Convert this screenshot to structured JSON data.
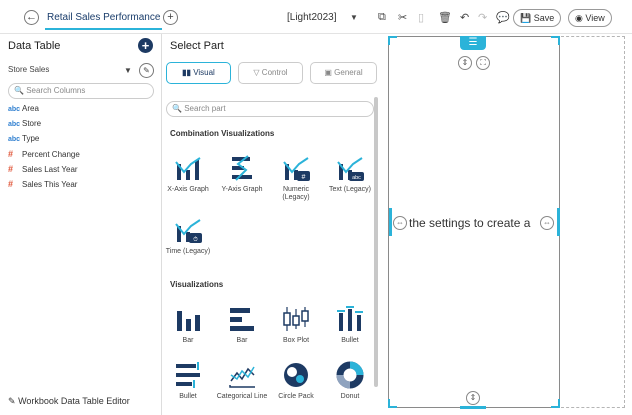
{
  "topbar": {
    "tab_label": "Retail Sales Performance",
    "theme": "[Light2023]",
    "save_label": "Save",
    "view_label": "View"
  },
  "left_panel": {
    "title": "Data Table",
    "source": "Store Sales",
    "search_placeholder": "Search Columns",
    "columns": [
      {
        "type": "abc",
        "name": "Area"
      },
      {
        "type": "abc",
        "name": "Store"
      },
      {
        "type": "abc",
        "name": "Type"
      },
      {
        "type": "#",
        "name": "Percent Change"
      },
      {
        "type": "#",
        "name": "Sales Last Year"
      },
      {
        "type": "#",
        "name": "Sales This Year"
      }
    ],
    "footer": "Workbook Data Table Editor"
  },
  "middle_panel": {
    "title": "Select Part",
    "tabs": [
      "Visual",
      "Control",
      "General"
    ],
    "search_placeholder": "Search part",
    "section1": "Combination Visualizations",
    "combination": [
      "X-Axis Graph",
      "Y-Axis Graph",
      "Numeric (Legacy)",
      "Text (Legacy)",
      "Time (Legacy)"
    ],
    "section2": "Visualizations",
    "visualizations": [
      "Bar",
      "Bar",
      "Box Plot",
      "Bullet",
      "Bullet",
      "Categorical Line",
      "Circle Pack",
      "Donut"
    ],
    "badge_num": "#",
    "badge_abc": "abc",
    "badge_time": "⏱"
  },
  "canvas": {
    "message": "the settings to create a"
  },
  "colors": {
    "accent": "#2bb3d9",
    "navy": "#1d3a63"
  }
}
